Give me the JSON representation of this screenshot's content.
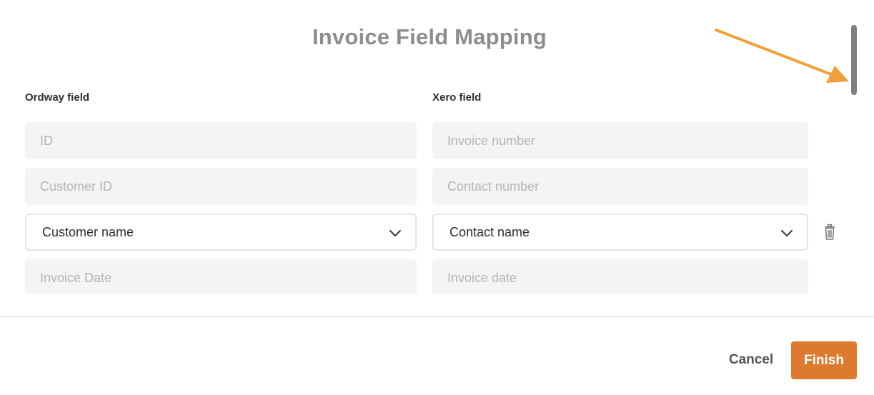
{
  "dialog": {
    "title": "Invoice Field Mapping",
    "left_column_label": "Ordway field",
    "right_column_label": "Xero field"
  },
  "rows": [
    {
      "ordway": "ID",
      "xero": "Invoice number",
      "editable": false
    },
    {
      "ordway": "Customer ID",
      "xero": "Contact number",
      "editable": false
    },
    {
      "ordway": "Customer name",
      "xero": "Contact name",
      "editable": true
    },
    {
      "ordway": "Invoice Date",
      "xero": "Invoice date",
      "editable": false
    }
  ],
  "icons": {
    "dropdown": "chevron-down-icon",
    "delete": "trash-icon",
    "annotation": "arrow-annotation-icon"
  },
  "footer": {
    "cancel_label": "Cancel",
    "finish_label": "Finish"
  },
  "colors": {
    "accent": "#de7a2e",
    "annotation_arrow": "#f0a03a",
    "title": "#8d8d8d"
  }
}
